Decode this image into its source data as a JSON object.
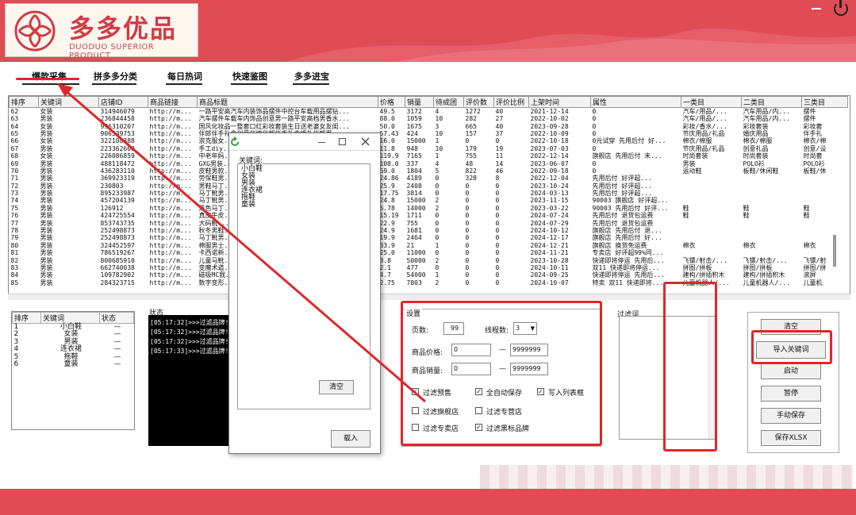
{
  "header": {
    "logo_name": "多多优品",
    "logo_sub": "DUODUO SUPERIOR PRODUCT",
    "accent_color": "#e04b56"
  },
  "tabs": [
    {
      "label": "爆款采集",
      "active": true
    },
    {
      "label": "拼多多分类"
    },
    {
      "label": "每日热词"
    },
    {
      "label": "快速鉴图"
    },
    {
      "label": "多多进宝"
    }
  ],
  "grid": {
    "columns": [
      "排序",
      "关键词",
      "店铺ID",
      "商品链接",
      "商品标题",
      "价格",
      "销量",
      "待成团",
      "评价数",
      "评价比例",
      "上架时间",
      "属性",
      "一类目",
      "二类目",
      "三类目"
    ],
    "rows": [
      [
        "62",
        "女装",
        "314946079",
        "http://m...",
        "一路平安高汽车内装饰品摆件中控台车载用品摆钻...",
        "49.5",
        "3172",
        "4",
        "1272",
        "40",
        "2021-12-14",
        "0",
        "汽车/用品/...",
        "汽车用品/内...",
        "摆件"
      ],
      [
        "63",
        "男装",
        "236844458",
        "http://m...",
        "汽车摆件车载车内饰品创意男一路平安高档男香水...",
        "88.0",
        "1059",
        "10",
        "282",
        "27",
        "2022-10-02",
        "0",
        "汽车/用品/...",
        "汽车用品/内...",
        "摆件"
      ],
      [
        "64",
        "女装",
        "996310207",
        "http://m...",
        "国风化妆品一整套口红彩妆套装生日送老婆女友闺...",
        "50.0",
        "1675",
        "3",
        "665",
        "40",
        "2023-09-28",
        "0",
        "彩妆/香水/...",
        "彩妆套装",
        "彩妆套"
      ],
      [
        "65",
        "男装",
        "906539753",
        "http://m...",
        "伴郎伴手礼盒创意伴娘伴郎伴手礼盒婚礼伴郎男...",
        "57.43",
        "424",
        "10",
        "157",
        "37",
        "2022-10-09",
        "0",
        "节庆用品/礼品",
        "婚庆用品",
        "伴手礼"
      ],
      [
        "66",
        "女装",
        "322108388",
        "http://m...",
        "浪克服女...",
        "16.0",
        "15000",
        "1",
        "0",
        "0",
        "2022-10-18",
        "0元试穿 先用后付 好...",
        "棉衣/棉服",
        "棉衣/棉服",
        "棉衣/棉"
      ],
      [
        "67",
        "男装",
        "223362600",
        "http://m...",
        "手工diy...",
        "11.8",
        "948",
        "10",
        "179",
        "19",
        "2023-07-03",
        "0",
        "节庆用品/礼品",
        "创意礼品",
        "创意/设"
      ],
      [
        "68",
        "女装",
        "226086859",
        "http://m...",
        "中老年妈...",
        "119.9",
        "7165",
        "1",
        "755",
        "11",
        "2022-12-14",
        "旗舰店 先用后付 未...",
        "时尚套装",
        "时尚套装",
        "时尚套"
      ],
      [
        "69",
        "男装",
        "488118472",
        "http://m...",
        "GXG男装...",
        "108.0",
        "337",
        "4",
        "48",
        "14",
        "2023-06-07",
        "0",
        "男装",
        "POLO衫",
        "POLO衫"
      ],
      [
        "70",
        "男装",
        "436283110",
        "http://m...",
        "皮鞋男款...",
        "59.0",
        "1804",
        "5",
        "822",
        "46",
        "2022-09-18",
        "0",
        "运动鞋",
        "板鞋/休闲鞋",
        "板鞋/休"
      ],
      [
        "71",
        "男装",
        "369923319",
        "http://m...",
        "劳保鞋男...",
        "24.86",
        "4189",
        "0",
        "328",
        "8",
        "2022-12-04",
        "先用后付 好评超...",
        "",
        "",
        ""
      ],
      [
        "72",
        "男装",
        "230803",
        "http://m...",
        "男鞋马丁...",
        "25.9",
        "2408",
        "0",
        "0",
        "0",
        "2023-10-24",
        "先用后付 好评超...",
        "",
        "",
        ""
      ],
      [
        "73",
        "男装",
        "895233987",
        "http://m...",
        "马丁靴男...",
        "17.75",
        "3814",
        "0",
        "0",
        "0",
        "2024-03-13",
        "先用后付 好评超...",
        "",
        "",
        ""
      ],
      [
        "74",
        "男装",
        "457204139",
        "http://m...",
        "马丁靴男...",
        "24.8",
        "15000",
        "2",
        "0",
        "0",
        "2023-11-15",
        "90003 旗舰店 好评超...",
        "",
        "",
        ""
      ],
      [
        "75",
        "男装",
        "126912",
        "http://m...",
        "黑色马丁...",
        "5.78",
        "14000",
        "2",
        "0",
        "0",
        "2023-03-22",
        "90003 先用后付 好评...",
        "鞋",
        "鞋",
        "鞋"
      ],
      [
        "76",
        "男装",
        "424725554",
        "http://m...",
        "真皮牛皮...",
        "15.19",
        "1711",
        "0",
        "0",
        "0",
        "2024-07-24",
        "先用后付 退货包运费",
        "鞋",
        "鞋",
        "鞋"
      ],
      [
        "77",
        "男装",
        "853743735",
        "http://m...",
        "大码靴...",
        "22.9",
        "755",
        "0",
        "0",
        "0",
        "2024-07-29",
        "先用后付 退货包运费",
        "",
        "",
        ""
      ],
      [
        "78",
        "男装",
        "252498873",
        "http://m...",
        "秋冬男鞋...",
        "24.9",
        "1681",
        "0",
        "0",
        "0",
        "2024-10-12",
        "旗舰店 先用后付 退...",
        "",
        "",
        ""
      ],
      [
        "79",
        "男装",
        "252498873",
        "http://m...",
        "马丁靴男...",
        "19.9",
        "2464",
        "0",
        "0",
        "0",
        "2024-12-17",
        "旗舰店 先用后付 好...",
        "",
        "",
        ""
      ],
      [
        "80",
        "男装",
        "324452597",
        "http://m...",
        "棉服男士...",
        "33.9",
        "21",
        "1",
        "0",
        "0",
        "2024-12-21",
        "旗舰店 换货免运费",
        "棉衣",
        "棉衣",
        "棉衣"
      ],
      [
        "81",
        "男装",
        "786519267",
        "http://m...",
        "卡西诺新...",
        "25.0",
        "11000",
        "0",
        "0",
        "0",
        "2024-11-21",
        "专卖店 好评超99%同...",
        "",
        "",
        ""
      ],
      [
        "82",
        "男装",
        "800685910",
        "http://m...",
        "儿童马靴...",
        "8.8",
        "50000",
        "2",
        "0",
        "0",
        "2023-10-28",
        "快递即将停运 先用后...",
        "飞镖/射击/...",
        "飞镖/射击/...",
        "飞镖/射"
      ],
      [
        "83",
        "男装",
        "662740038",
        "http://m...",
        "变魔术道...",
        "2.1",
        "477",
        "0",
        "0",
        "0",
        "2024-10-11",
        "双11 快递即将停运...",
        "拼图/拼板",
        "拼图/拼板",
        "拼图/拼"
      ],
      [
        "84",
        "男装",
        "109782902",
        "http://m...",
        "磁吸MC我...",
        "4.7",
        "54000",
        "1",
        "0",
        "0",
        "2024-09-25",
        "快递即将停运 先用后...",
        "建构/拼插积木",
        "建构/拼插积木",
        "滚屏"
      ],
      [
        "85",
        "男装",
        "284323715",
        "http://m...",
        "数字变形...",
        "2.75",
        "7803",
        "2",
        "0",
        "0",
        "2024-10-07",
        "特卖 双11 快递即将...",
        "儿童机器人/...",
        "儿童机器人/...",
        "儿童机"
      ]
    ]
  },
  "keywords_panel": {
    "columns": [
      "排序",
      "关键词",
      "状态"
    ],
    "rows": [
      [
        "1",
        "小白鞋",
        "—"
      ],
      [
        "2",
        "女装",
        "—"
      ],
      [
        "3",
        "男装",
        "—"
      ],
      [
        "4",
        "连衣裙",
        "—"
      ],
      [
        "5",
        "拖鞋",
        "—"
      ],
      [
        "6",
        "童装",
        "—"
      ]
    ]
  },
  "status": {
    "label": "状态",
    "logs": [
      "[05:17:32]>>>过滤品牌!",
      "[05:17:32]>>>过滤品牌!",
      "[05:17:32]>>>过滤品牌!",
      "[05:17:33]>>>过滤品牌!"
    ]
  },
  "dialog": {
    "label": "关键词:",
    "items": [
      "小白鞋",
      "女装",
      "男装",
      "连衣裙",
      "拖鞋",
      "童装"
    ],
    "clear_label": "清空",
    "load_label": "载入"
  },
  "settings": {
    "title": "设置",
    "pages_label": "页数:",
    "pages_value": "99",
    "threads_label": "线程数:",
    "threads_value": "3",
    "price_label": "商品价格:",
    "price_min": "0",
    "price_max": "9999999",
    "sales_label": "商品销量:",
    "sales_min": "0",
    "sales_max": "9999999",
    "dash": "—",
    "checks": [
      {
        "label": "过滤预售",
        "checked": true
      },
      {
        "label": "全自动保存",
        "checked": true
      },
      {
        "label": "写入列表框",
        "checked": true
      },
      {
        "label": "过滤旗舰店",
        "checked": false
      },
      {
        "label": "过滤专营店",
        "checked": false
      },
      {
        "label": "过滤专卖店",
        "checked": false
      },
      {
        "label": "过滤黑标品牌",
        "checked": true
      }
    ]
  },
  "filter": {
    "label": "过滤词"
  },
  "actions": {
    "clear": "清空",
    "import_keywords": "导入关键词",
    "start": "启动",
    "pause": "暂停",
    "manual_save": "手动保存",
    "save_xlsx": "保存XLSX"
  }
}
